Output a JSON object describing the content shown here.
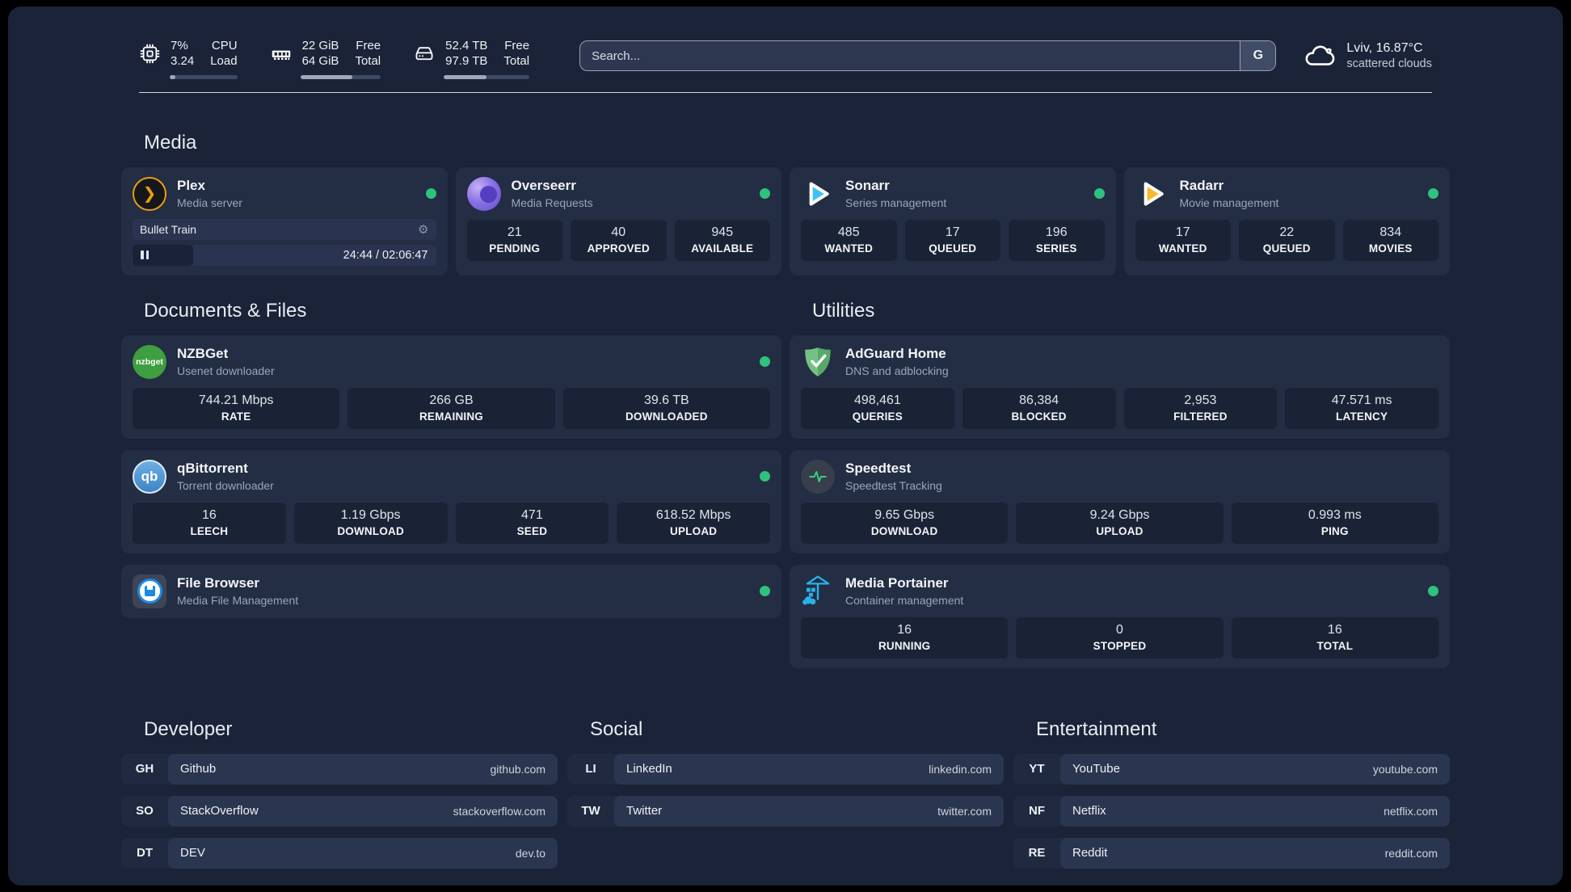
{
  "topbar": {
    "cpu": {
      "value_top": "7%",
      "value_bottom": "3.24",
      "label_top": "CPU",
      "label_bottom": "Load",
      "progress": 8
    },
    "ram": {
      "value_top": "22 GiB",
      "value_bottom": "64 GiB",
      "label_top": "Free",
      "label_bottom": "Total",
      "progress": 65
    },
    "disk": {
      "value_top": "52.4 TB",
      "value_bottom": "97.9 TB",
      "label_top": "Free",
      "label_bottom": "Total",
      "progress": 50
    },
    "search": {
      "placeholder": "Search...",
      "button_label": "G"
    },
    "weather": {
      "location": "Lviv, 16.87°C",
      "condition": "scattered clouds"
    }
  },
  "icons": {
    "gear": "⚙",
    "plex_chevron": "❯",
    "nzbget_text": "nzbget",
    "qbittorrent_text": "qb"
  },
  "brand_colors": {
    "status_online": "#2ec27e",
    "plex_gold": "#e5a00d",
    "overseerr_purple": "#8a72e4",
    "sonarr_blue": "#3fc3f7",
    "radarr_yellow": "#f5b82e",
    "nzbget_green": "#3f9e3f",
    "qbittorrent_blue": "#4f94d4",
    "adguard_green": "#68bc71",
    "speedtest_pulse": "#35d07f",
    "portainer_blue": "#28b0ea",
    "filebrowser_blue": "#1e88e5"
  },
  "sections": {
    "media": {
      "title": "Media",
      "services": [
        {
          "name": "Plex",
          "desc": "Media server",
          "status": "online",
          "player": {
            "title": "Bullet Train",
            "time": "24:44 / 02:06:47",
            "progress": 20
          }
        },
        {
          "name": "Overseerr",
          "desc": "Media Requests",
          "status": "online",
          "stats": [
            {
              "value": "21",
              "label": "PENDING"
            },
            {
              "value": "40",
              "label": "APPROVED"
            },
            {
              "value": "945",
              "label": "AVAILABLE"
            }
          ]
        },
        {
          "name": "Sonarr",
          "desc": "Series management",
          "status": "online",
          "stats": [
            {
              "value": "485",
              "label": "WANTED"
            },
            {
              "value": "17",
              "label": "QUEUED"
            },
            {
              "value": "196",
              "label": "SERIES"
            }
          ]
        },
        {
          "name": "Radarr",
          "desc": "Movie management",
          "status": "online",
          "stats": [
            {
              "value": "17",
              "label": "WANTED"
            },
            {
              "value": "22",
              "label": "QUEUED"
            },
            {
              "value": "834",
              "label": "MOVIES"
            }
          ]
        }
      ]
    },
    "documents": {
      "title": "Documents & Files",
      "services": [
        {
          "name": "NZBGet",
          "desc": "Usenet downloader",
          "status": "online",
          "stats": [
            {
              "value": "744.21 Mbps",
              "label": "RATE"
            },
            {
              "value": "266 GB",
              "label": "REMAINING"
            },
            {
              "value": "39.6 TB",
              "label": "DOWNLOADED"
            }
          ]
        },
        {
          "name": "qBittorrent",
          "desc": "Torrent downloader",
          "status": "online",
          "stats": [
            {
              "value": "16",
              "label": "LEECH"
            },
            {
              "value": "1.19 Gbps",
              "label": "DOWNLOAD"
            },
            {
              "value": "471",
              "label": "SEED"
            },
            {
              "value": "618.52 Mbps",
              "label": "UPLOAD"
            }
          ]
        },
        {
          "name": "File Browser",
          "desc": "Media File Management",
          "status": "online"
        }
      ]
    },
    "utilities": {
      "title": "Utilities",
      "services": [
        {
          "name": "AdGuard Home",
          "desc": "DNS and adblocking",
          "stats": [
            {
              "value": "498,461",
              "label": "QUERIES"
            },
            {
              "value": "86,384",
              "label": "BLOCKED"
            },
            {
              "value": "2,953",
              "label": "FILTERED"
            },
            {
              "value": "47.571 ms",
              "label": "LATENCY"
            }
          ]
        },
        {
          "name": "Speedtest",
          "desc": "Speedtest Tracking",
          "stats": [
            {
              "value": "9.65 Gbps",
              "label": "DOWNLOAD"
            },
            {
              "value": "9.24 Gbps",
              "label": "UPLOAD"
            },
            {
              "value": "0.993 ms",
              "label": "PING"
            }
          ]
        },
        {
          "name": "Media Portainer",
          "desc": "Container management",
          "status": "online",
          "stats": [
            {
              "value": "16",
              "label": "RUNNING"
            },
            {
              "value": "0",
              "label": "STOPPED"
            },
            {
              "value": "16",
              "label": "TOTAL"
            }
          ]
        }
      ]
    }
  },
  "bookmarks": [
    {
      "title": "Developer",
      "items": [
        {
          "abbr": "GH",
          "name": "Github",
          "url": "github.com"
        },
        {
          "abbr": "SO",
          "name": "StackOverflow",
          "url": "stackoverflow.com"
        },
        {
          "abbr": "DT",
          "name": "DEV",
          "url": "dev.to"
        }
      ]
    },
    {
      "title": "Social",
      "items": [
        {
          "abbr": "LI",
          "name": "LinkedIn",
          "url": "linkedin.com"
        },
        {
          "abbr": "TW",
          "name": "Twitter",
          "url": "twitter.com"
        }
      ]
    },
    {
      "title": "Entertainment",
      "items": [
        {
          "abbr": "YT",
          "name": "YouTube",
          "url": "youtube.com"
        },
        {
          "abbr": "NF",
          "name": "Netflix",
          "url": "netflix.com"
        },
        {
          "abbr": "RE",
          "name": "Reddit",
          "url": "reddit.com"
        }
      ]
    }
  ]
}
